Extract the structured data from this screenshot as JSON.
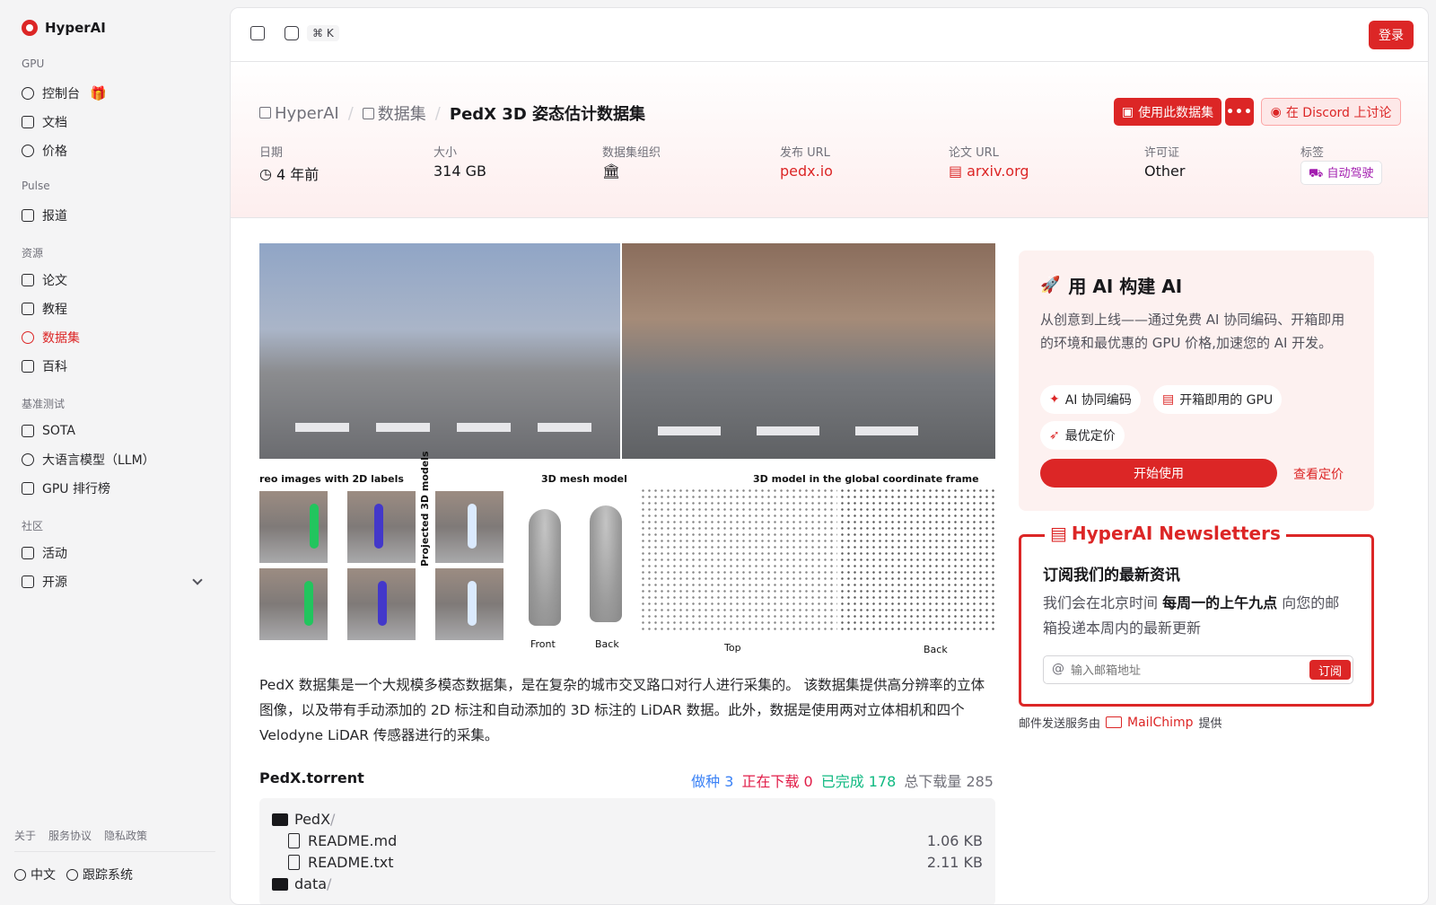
{
  "app": {
    "name": "HyperAI",
    "brand_color": "#dc2626"
  },
  "sidebar": {
    "sections": [
      {
        "title": "GPU",
        "items": [
          {
            "label": "控制台",
            "icon": "gauge-icon"
          },
          {
            "label": "文档",
            "icon": "document-icon"
          },
          {
            "label": "价格",
            "icon": "dollar-icon"
          }
        ]
      },
      {
        "title": "Pulse",
        "items": [
          {
            "label": "报道",
            "icon": "newspaper-icon"
          }
        ]
      },
      {
        "title": "资源",
        "items": [
          {
            "label": "论文",
            "icon": "paper-icon"
          },
          {
            "label": "教程",
            "icon": "book-icon"
          },
          {
            "label": "数据集",
            "icon": "database-icon",
            "active": true
          },
          {
            "label": "百科",
            "icon": "encyclopedia-icon"
          }
        ]
      },
      {
        "title": "基准测试",
        "items": [
          {
            "label": "SOTA",
            "icon": "chart-icon"
          },
          {
            "label": "大语言模型（LLM）",
            "icon": "sparkle-icon"
          },
          {
            "label": "GPU 排行榜",
            "icon": "chip-icon"
          }
        ]
      },
      {
        "title": "社区",
        "items": [
          {
            "label": "活动",
            "icon": "calendar-icon"
          },
          {
            "label": "开源",
            "icon": "list-icon"
          }
        ]
      }
    ],
    "footer_links": [
      "关于",
      "服务协议",
      "隐私政策"
    ],
    "language": "中文",
    "tracking": "跟踪系统"
  },
  "topbar": {
    "shortcut": "⌘ K",
    "login": "登录"
  },
  "breadcrumb": {
    "home": "HyperAI",
    "section": "数据集",
    "current": "PedX 3D 姿态估计数据集"
  },
  "actions": {
    "use_dataset": "使用此数据集",
    "more": "•••",
    "discord": "在 Discord 上讨论"
  },
  "meta": {
    "date_label": "日期",
    "date_value": "4 年前",
    "size_label": "大小",
    "size_value": "314 GB",
    "org_label": "数据集组织",
    "publish_label": "发布 URL",
    "publish_value": "pedx.io",
    "paper_label": "论文 URL",
    "paper_value": "arxiv.org",
    "license_label": "许可证",
    "license_value": "Other",
    "tags_label": "标签",
    "tag": "自动驾驶"
  },
  "figure": {
    "caption_left": "reo images with 2D labels",
    "caption_mid": "3D mesh model",
    "caption_right": "3D model in the global coordinate frame",
    "vertical_label": "Projected 3D models",
    "front": "Front",
    "back1": "Back",
    "top": "Top",
    "back2": "Back"
  },
  "description": "PedX 数据集是一个大规模多模态数据集，是在复杂的城市交叉路口对行人进行采集的。 该数据集提供高分辨率的立体图像，以及带有手动添加的 2D 标注和自动添加的 3D 标注的 LiDAR 数据。此外，数据是使用两对立体相机和四个 Velodyne LiDAR 传感器进行的采集。",
  "torrent": {
    "name": "PedX.torrent",
    "seeding": "做种 3",
    "downloading": "正在下载 0",
    "completed": "已完成 178",
    "total": "总下载量 285",
    "files": [
      {
        "name": "PedX",
        "suffix": "/",
        "type": "folder",
        "size": ""
      },
      {
        "name": "README.md",
        "suffix": "",
        "type": "file",
        "size": "1.06 KB"
      },
      {
        "name": "README.txt",
        "suffix": "",
        "type": "file",
        "size": "2.11 KB"
      },
      {
        "name": "data",
        "suffix": "/",
        "type": "folder",
        "size": ""
      }
    ]
  },
  "promo": {
    "title": "用 AI 构建 AI",
    "text": "从创意到上线——通过免费 AI 协同编码、开箱即用的环境和最优惠的 GPU 价格,加速您的 AI 开发。",
    "pills": [
      "AI 协同编码",
      "开箱即用的 GPU",
      "最优定价"
    ],
    "start": "开始使用",
    "pricing": "查看定价"
  },
  "newsletter": {
    "legend": "HyperAI Newsletters",
    "heading": "订阅我们的最新资讯",
    "text_before": "我们会在北京时间 ",
    "text_bold": "每周一的上午九点",
    "text_after": " 向您的邮箱投递本周内的最新更新",
    "placeholder": "输入邮箱地址",
    "subscribe": "订阅",
    "provider_before": "邮件发送服务由",
    "provider": "MailChimp",
    "provider_after": "提供"
  }
}
